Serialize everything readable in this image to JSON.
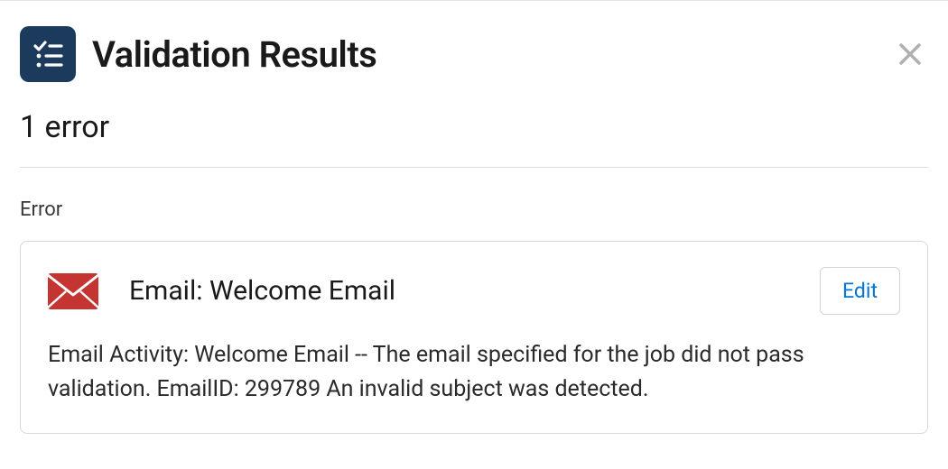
{
  "header": {
    "title": "Validation Results"
  },
  "summary": {
    "count_text": "1 error"
  },
  "section": {
    "label": "Error"
  },
  "error_card": {
    "title": "Email: Welcome Email",
    "edit_label": "Edit",
    "message": "Email Activity: Welcome Email -- The email specified for the job did not pass validation. EmailID: 299789 An invalid subject was detected."
  }
}
